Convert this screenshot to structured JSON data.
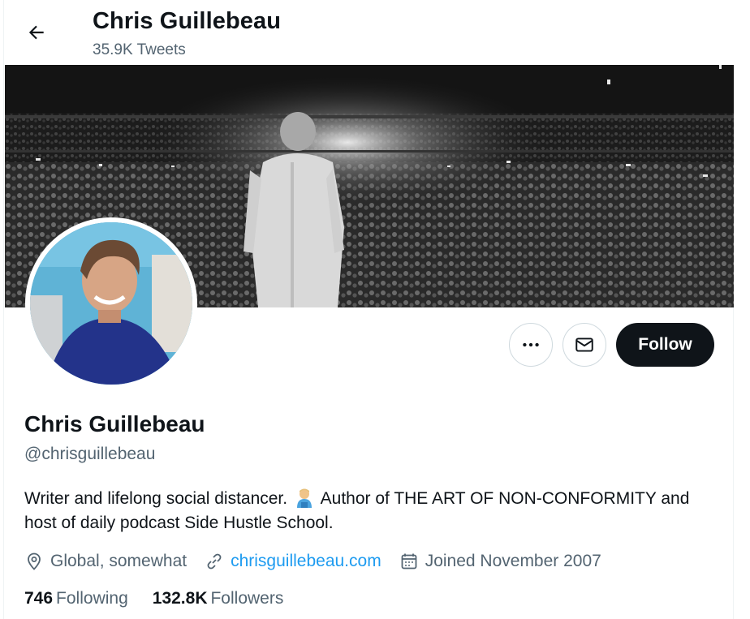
{
  "header": {
    "name": "Chris Guillebeau",
    "tweet_count": "35.9K Tweets"
  },
  "profile": {
    "name": "Chris Guillebeau",
    "handle": "@chrisguillebeau",
    "bio_part1": "Writer and lifelong social distancer.",
    "bio_emoji": "person-emoji",
    "bio_part2": "Author of THE ART OF NON-CONFORMITY and host of daily podcast Side Hustle School.",
    "location": "Global, somewhat",
    "website": "chrisguillebeau.com",
    "joined": "Joined November 2007"
  },
  "stats": {
    "following_count": "746",
    "following_label": "Following",
    "followers_count": "132.8K",
    "followers_label": "Followers"
  },
  "actions": {
    "follow_label": "Follow",
    "more_icon": "more-icon",
    "message_icon": "envelope-icon"
  },
  "colors": {
    "accent": "#1d9bf0",
    "text": "#0f1419",
    "secondary": "#536471",
    "follow_bg": "#0f1419"
  }
}
